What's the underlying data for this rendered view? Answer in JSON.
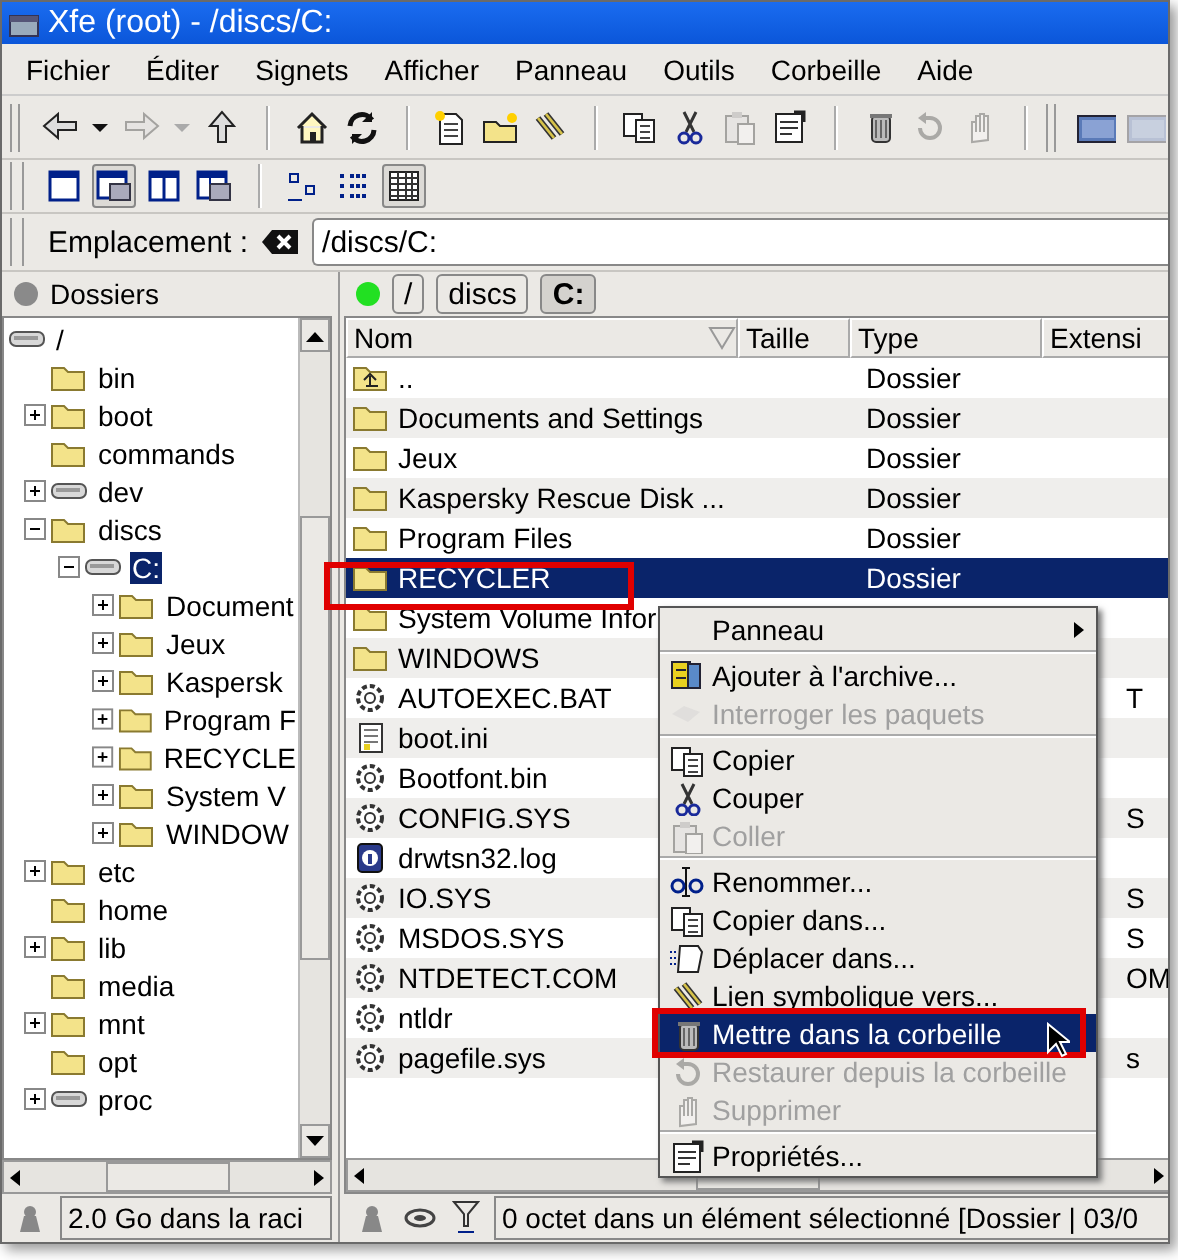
{
  "window": {
    "title": "Xfe (root) - /discs/C:"
  },
  "menu_bar": [
    "Fichier",
    "Éditer",
    "Signets",
    "Afficher",
    "Panneau",
    "Outils",
    "Corbeille",
    "Aide"
  ],
  "toolbar": [
    {
      "kind": "back",
      "disabled": false
    },
    {
      "kind": "caret",
      "disabled": false
    },
    {
      "kind": "forward",
      "disabled": true
    },
    {
      "kind": "caret",
      "disabled": true
    },
    {
      "kind": "up",
      "disabled": false
    },
    {
      "kind": "sep"
    },
    {
      "kind": "home",
      "disabled": false
    },
    {
      "kind": "refresh",
      "disabled": false
    },
    {
      "kind": "sep"
    },
    {
      "kind": "newfile",
      "disabled": false
    },
    {
      "kind": "newfolder",
      "disabled": false
    },
    {
      "kind": "link",
      "disabled": false
    },
    {
      "kind": "sep"
    },
    {
      "kind": "copy",
      "disabled": false
    },
    {
      "kind": "cut",
      "disabled": false
    },
    {
      "kind": "paste",
      "disabled": true
    },
    {
      "kind": "props",
      "disabled": false
    },
    {
      "kind": "sep"
    },
    {
      "kind": "trash",
      "disabled": false
    },
    {
      "kind": "restore",
      "disabled": true
    },
    {
      "kind": "delete",
      "disabled": true
    },
    {
      "kind": "grip"
    },
    {
      "kind": "terminal",
      "disabled": false
    },
    {
      "kind": "terminal",
      "disabled": true
    }
  ],
  "view_toolbar": [
    {
      "kind": "onepanel",
      "selected": false
    },
    {
      "kind": "treepanel",
      "selected": true
    },
    {
      "kind": "twopanels",
      "selected": false
    },
    {
      "kind": "treetwo",
      "selected": false
    },
    {
      "kind": "sep"
    },
    {
      "kind": "bigicons",
      "selected": false
    },
    {
      "kind": "smallicons",
      "selected": false
    },
    {
      "kind": "details",
      "selected": true
    }
  ],
  "location": {
    "label": "Emplacement :",
    "value": "/discs/C:"
  },
  "tree": {
    "title": "Dossiers",
    "items": [
      {
        "label": "/",
        "kind": "drive",
        "selected": false,
        "children": [
          {
            "label": "bin",
            "kind": "folder",
            "selected": false
          },
          {
            "label": "boot",
            "kind": "folder",
            "expanded": false,
            "selected": false
          },
          {
            "label": "commands",
            "kind": "folder",
            "selected": false
          },
          {
            "label": "dev",
            "kind": "drive",
            "expanded": false,
            "selected": false
          },
          {
            "label": "discs",
            "kind": "folder",
            "expanded": true,
            "selected": false,
            "children": [
              {
                "label": "C:",
                "kind": "drive",
                "expanded": true,
                "selected": true,
                "children": [
                  {
                    "label": "Document",
                    "kind": "folder",
                    "expanded": false,
                    "selected": false
                  },
                  {
                    "label": "Jeux",
                    "kind": "folder",
                    "expanded": false,
                    "selected": false
                  },
                  {
                    "label": "Kaspersk",
                    "kind": "folder",
                    "expanded": false,
                    "selected": false
                  },
                  {
                    "label": "Program F",
                    "kind": "folder",
                    "expanded": false,
                    "selected": false
                  },
                  {
                    "label": "RECYCLE",
                    "kind": "folder",
                    "expanded": false,
                    "selected": false
                  },
                  {
                    "label": "System V",
                    "kind": "folder",
                    "expanded": false,
                    "selected": false
                  },
                  {
                    "label": "WINDOW",
                    "kind": "folder",
                    "expanded": false,
                    "selected": false
                  }
                ]
              }
            ]
          },
          {
            "label": "etc",
            "kind": "folder",
            "expanded": false,
            "selected": false
          },
          {
            "label": "home",
            "kind": "folder",
            "selected": false
          },
          {
            "label": "lib",
            "kind": "folder",
            "expanded": false,
            "selected": false
          },
          {
            "label": "media",
            "kind": "folder",
            "selected": false
          },
          {
            "label": "mnt",
            "kind": "folder",
            "expanded": false,
            "selected": false
          },
          {
            "label": "opt",
            "kind": "folder",
            "selected": false
          },
          {
            "label": "proc",
            "kind": "drive",
            "expanded": false,
            "selected": false
          }
        ]
      }
    ],
    "status": "2.0 Go dans la raci"
  },
  "breadcrumbs": [
    {
      "label": "/",
      "selected": false
    },
    {
      "label": "discs",
      "selected": false
    },
    {
      "label": "C:",
      "selected": true
    }
  ],
  "file_list": {
    "columns": [
      "Nom",
      "Taille",
      "Type",
      "Extensi"
    ],
    "rows": [
      {
        "name": "..",
        "kind": "parent",
        "type": "Dossier",
        "selected": false
      },
      {
        "name": "Documents and Settings",
        "kind": "folder",
        "type": "Dossier",
        "selected": false
      },
      {
        "name": "Jeux",
        "kind": "folder",
        "type": "Dossier",
        "selected": false
      },
      {
        "name": "Kaspersky Rescue Disk ...",
        "kind": "folder",
        "type": "Dossier",
        "selected": false
      },
      {
        "name": "Program Files",
        "kind": "folder",
        "type": "Dossier",
        "selected": false
      },
      {
        "name": "RECYCLER",
        "kind": "folder",
        "type": "Dossier",
        "selected": true
      },
      {
        "name": "System Volume Infor",
        "kind": "folder",
        "selected": false
      },
      {
        "name": "WINDOWS",
        "kind": "folder",
        "selected": false
      },
      {
        "name": "AUTOEXEC.BAT",
        "kind": "gear",
        "extension": "T",
        "selected": false
      },
      {
        "name": "boot.ini",
        "kind": "text",
        "selected": false
      },
      {
        "name": "Bootfont.bin",
        "kind": "gear",
        "selected": false
      },
      {
        "name": "CONFIG.SYS",
        "kind": "gear",
        "extension": "S",
        "selected": false
      },
      {
        "name": "drwtsn32.log",
        "kind": "info",
        "selected": false
      },
      {
        "name": "IO.SYS",
        "kind": "gear",
        "extension": "S",
        "selected": false
      },
      {
        "name": "MSDOS.SYS",
        "kind": "gear",
        "extension": "S",
        "selected": false
      },
      {
        "name": "NTDETECT.COM",
        "kind": "gear",
        "extension": "OM",
        "selected": false
      },
      {
        "name": "ntldr",
        "kind": "gear",
        "selected": false
      },
      {
        "name": "pagefile.sys",
        "kind": "gear",
        "extension": "s",
        "selected": false
      }
    ],
    "status": "0 octet dans un élément sélectionné [Dossier | 03/0"
  },
  "context_menu": [
    {
      "kind": "plain",
      "label": "Panneau",
      "submenu": true,
      "disabled": false,
      "highlighted": false
    },
    {
      "kind": "separator"
    },
    {
      "kind": "archive",
      "label": "Ajouter à l'archive...",
      "disabled": false,
      "highlighted": false
    },
    {
      "kind": "package",
      "label": "Interroger les paquets",
      "disabled": true,
      "highlighted": false
    },
    {
      "kind": "separator"
    },
    {
      "kind": "copy",
      "label": "Copier",
      "disabled": false,
      "highlighted": false
    },
    {
      "kind": "cut",
      "label": "Couper",
      "disabled": false,
      "highlighted": false
    },
    {
      "kind": "paste",
      "label": "Coller",
      "disabled": true,
      "highlighted": false
    },
    {
      "kind": "separator"
    },
    {
      "kind": "rename",
      "label": "Renommer...",
      "disabled": false,
      "highlighted": false
    },
    {
      "kind": "copy",
      "label": "Copier dans...",
      "disabled": false,
      "highlighted": false
    },
    {
      "kind": "move",
      "label": "Déplacer dans...",
      "disabled": false,
      "highlighted": false
    },
    {
      "kind": "link",
      "label": "Lien symbolique vers...",
      "disabled": false,
      "highlighted": false
    },
    {
      "kind": "trash",
      "label": "Mettre dans la corbeille",
      "disabled": false,
      "highlighted": true
    },
    {
      "kind": "restore",
      "label": "Restaurer depuis la corbeille",
      "disabled": true,
      "highlighted": false
    },
    {
      "kind": "delete",
      "label": "Supprimer",
      "disabled": true,
      "highlighted": false
    },
    {
      "kind": "separator"
    },
    {
      "kind": "props",
      "label": "Propriétés...",
      "disabled": false,
      "highlighted": false
    }
  ]
}
